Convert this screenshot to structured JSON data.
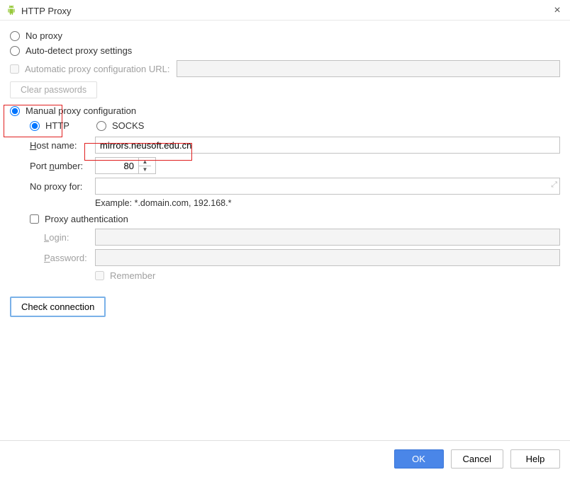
{
  "titlebar": {
    "title": "HTTP Proxy",
    "close_icon": "×"
  },
  "proxy_mode": {
    "no_proxy": "No proxy",
    "auto_detect": "Auto-detect proxy settings",
    "auto_config_url_label": "Automatic proxy configuration URL:",
    "auto_config_url_value": "",
    "clear_passwords_btn": "Clear passwords",
    "manual": "Manual proxy configuration",
    "selected": "manual"
  },
  "manual": {
    "protocol": {
      "http": "HTTP",
      "socks": "SOCKS",
      "selected": "http"
    },
    "host_label_pre": "H",
    "host_label_rest": "ost name:",
    "host_value": "mirrors.neusoft.edu.cn",
    "port_label_pre": "Port ",
    "port_label_underline": "n",
    "port_label_post": "umber:",
    "port_value": "80",
    "no_proxy_for_label": "No proxy for:",
    "no_proxy_for_value": "",
    "example_text": "Example: *.domain.com, 192.168.*"
  },
  "auth": {
    "checkbox_label": "Proxy authentication",
    "login_label_underline": "L",
    "login_label_rest": "ogin:",
    "login_value": "",
    "password_label_underline": "P",
    "password_label_rest": "assword:",
    "password_value": "",
    "remember_label": "Remember"
  },
  "actions": {
    "check_connection": "Check connection"
  },
  "footer": {
    "ok": "OK",
    "cancel": "Cancel",
    "help": "Help"
  }
}
